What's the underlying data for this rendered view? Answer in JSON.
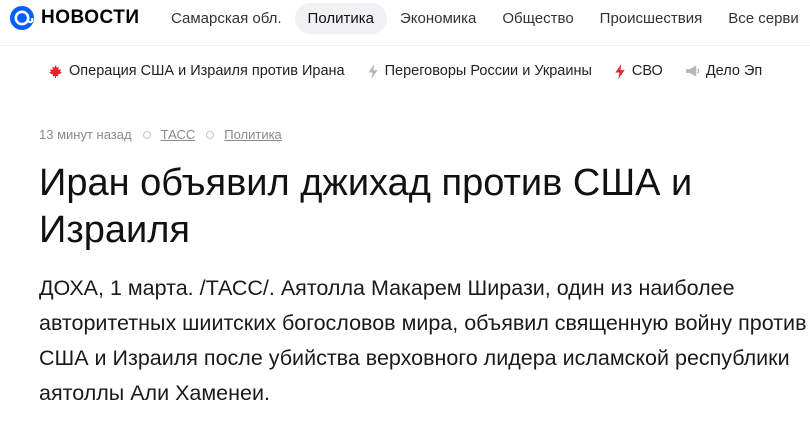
{
  "header": {
    "logo_text": "НОВОСТИ",
    "brand_color": "#005ff9",
    "nav": [
      {
        "label": "Самарская обл.",
        "active": false
      },
      {
        "label": "Политика",
        "active": true
      },
      {
        "label": "Экономика",
        "active": false
      },
      {
        "label": "Общество",
        "active": false
      },
      {
        "label": "Происшествия",
        "active": false
      },
      {
        "label": "Все серви",
        "active": false
      }
    ]
  },
  "topics": [
    {
      "label": "Операция США и Израиля против Ирана",
      "icon": "maple-leaf-icon"
    },
    {
      "label": "Переговоры России и Украины",
      "icon": "lightning-icon"
    },
    {
      "label": "СВО",
      "icon": "lightning-red-icon"
    },
    {
      "label": "Дело Эп",
      "icon": "megaphone-icon"
    }
  ],
  "article": {
    "time": "13 минут назад",
    "source": "ТАСС",
    "rubric": "Политика",
    "title": "Иран объявил джихад против США и Израиля",
    "lead": "ДОХА, 1 марта. /ТАСС/. Аятолла Макарем Ширази, один из наиболее авторитетных шиитских богословов мира, объявил священную войну против США и Израиля после убийства верховного лидера исламской республики аятоллы Али Хаменеи."
  }
}
